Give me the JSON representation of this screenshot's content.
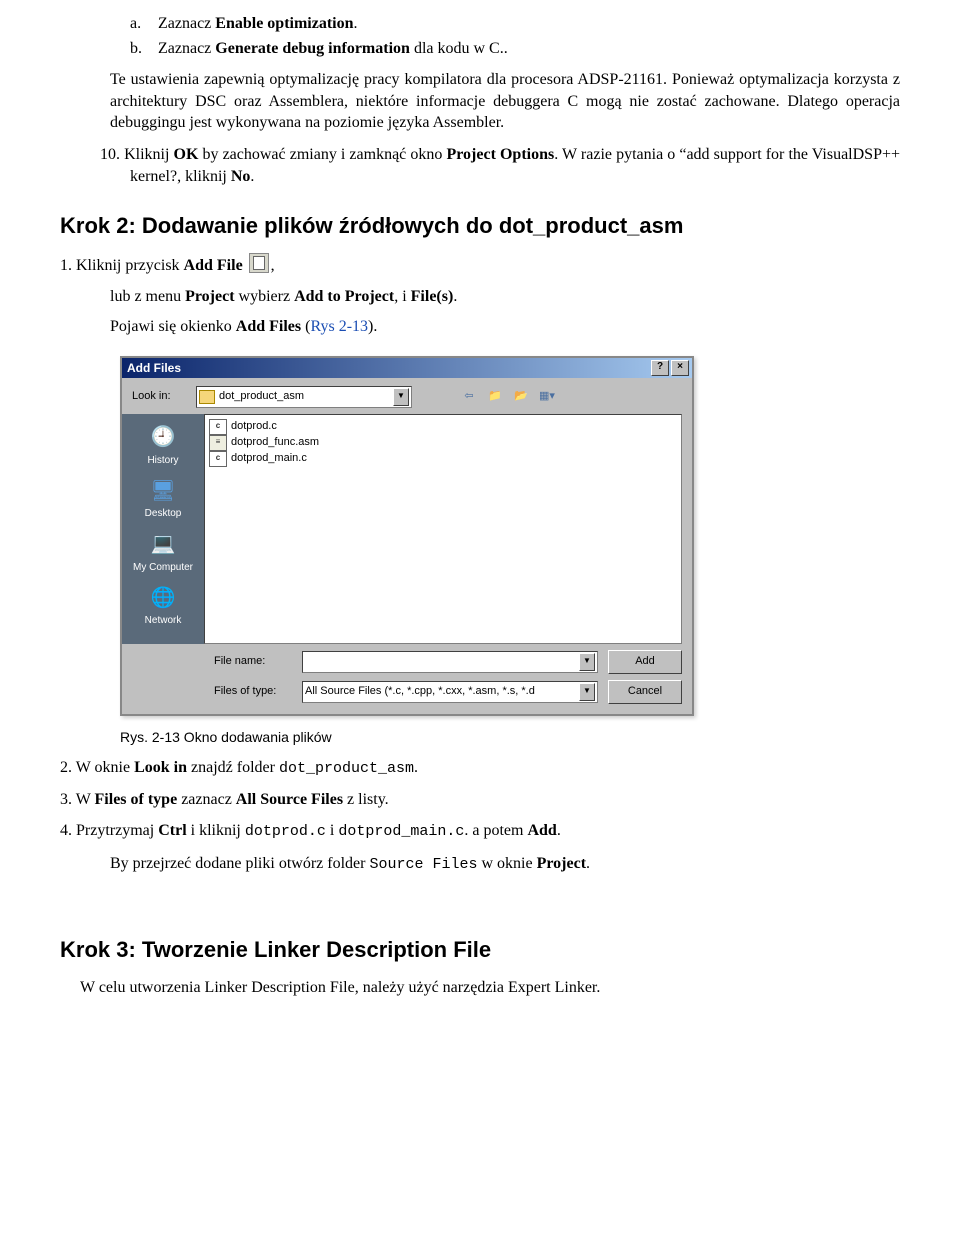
{
  "items": {
    "a": {
      "label": "a.",
      "prefix": "Zaznacz ",
      "bold": "Enable optimization",
      "suffix": "."
    },
    "b": {
      "label": "b.",
      "prefix": "Zaznacz ",
      "bold": "Generate debug information",
      "suffix": " dla kodu w C.."
    }
  },
  "para1": "Te ustawienia zapewnią optymalizację pracy kompilatora dla procesora ADSP-21161. Ponieważ optymalizacja korzysta z architektury DSC oraz Assemblera, niektóre informacje debuggera C mogą nie zostać zachowane. Dlatego operacja debuggingu jest wykonywana na poziomie języka Assembler.",
  "item10": {
    "num": "10.",
    "p1": "Kliknij ",
    "b1": "OK",
    "p2": " by zachować zmiany i zamknąć okno ",
    "b2": "Project Options",
    "p3": ". W razie pytania o “add support for the VisualDSP++ kernel?, kliknij ",
    "b3": "No",
    "p4": "."
  },
  "krok2": "Krok 2: Dodawanie plików źródłowych do dot_product_asm",
  "step1": {
    "num": "1.",
    "p1": " Kliknij przycisk ",
    "b1": "Add File",
    "suffix": ","
  },
  "sub1": {
    "p1": "lub z menu ",
    "b1": "Project",
    "p2": " wybierz ",
    "b2": "Add to Project",
    "p3": ", i ",
    "b3": "File(s)",
    "p4": "."
  },
  "sub2": {
    "p1": "Pojawi się okienko ",
    "b1": "Add Files",
    "p2": " (",
    "link": "Rys 2-13",
    "p3": ")."
  },
  "dialog": {
    "title": "Add Files",
    "help": "?",
    "close": "×",
    "look_in_label": "Look in:",
    "look_in_value": "dot_product_asm",
    "places": {
      "history": "History",
      "desktop": "Desktop",
      "mycomputer": "My Computer",
      "network": "Network"
    },
    "files": [
      {
        "icon": "c",
        "name": "dotprod.c"
      },
      {
        "icon": "asm",
        "name": "dotprod_func.asm"
      },
      {
        "icon": "c",
        "name": "dotprod_main.c"
      }
    ],
    "filename_label": "File name:",
    "filename_value": "",
    "filetype_label": "Files of type:",
    "filetype_value": "All Source Files (*.c, *.cpp, *.cxx, *.asm, *.s, *.d",
    "btn_add": "Add",
    "btn_cancel": "Cancel"
  },
  "caption": "Rys. 2-13 Okno dodawania plików",
  "step2": {
    "num": "2.",
    "p1": " W oknie ",
    "b1": "Look in",
    "p2": " znajdź folder ",
    "m1": "dot_product_asm",
    "p3": "."
  },
  "step3": {
    "num": "3.",
    "p1": " W ",
    "b1": "Files of type",
    "p2": " zaznacz ",
    "b2": "All Source Files",
    "p3": " z listy."
  },
  "step4": {
    "num": "4.",
    "p1": " Przytrzymaj ",
    "b1": "Ctrl",
    "p2": " i kliknij ",
    "m1": "dotprod.c",
    "p3": " i ",
    "m2": "dotprod_main.c",
    "p4": ". a potem ",
    "b2": "Add",
    "p5": "."
  },
  "step4sub": {
    "p1": "By przejrzeć dodane pliki otwórz folder ",
    "m1": "Source Files",
    "p2": " w oknie ",
    "b1": "Project",
    "p3": "."
  },
  "krok3": "Krok 3: Tworzenie Linker Description File",
  "krok3_p": "W celu utworzenia Linker Description File, należy użyć narzędzia Expert Linker."
}
